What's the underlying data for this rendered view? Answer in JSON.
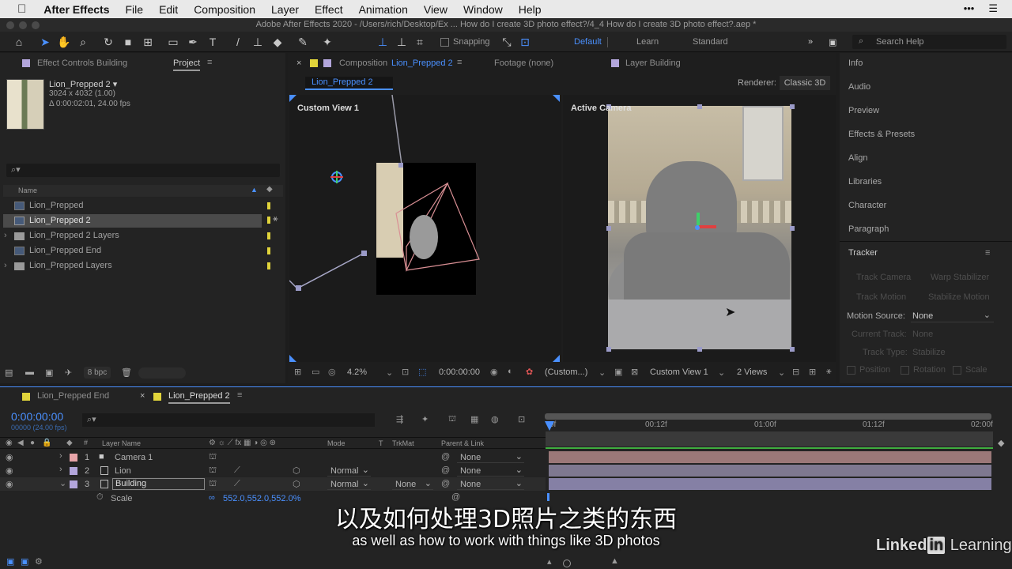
{
  "menubar": {
    "apple": "",
    "app_name": "After Effects",
    "items": [
      "File",
      "Edit",
      "Composition",
      "Layer",
      "Effect",
      "Animation",
      "View",
      "Window",
      "Help"
    ]
  },
  "window_title": "Adobe After Effects 2020 - /Users/rich/Desktop/Ex ... How do I create 3D photo effect?/4_4 How do I create 3D photo effect?.aep *",
  "toolbar": {
    "snapping_label": "Snapping",
    "workspaces": [
      "Default",
      "Learn",
      "Standard"
    ],
    "search_placeholder": "Search Help"
  },
  "project_panel": {
    "tab_effect_controls": "Effect Controls Building",
    "tab_project": "Project",
    "selected_name": "Lion_Prepped 2 ▾",
    "selected_dims": "3024 x 4032 (1.00)",
    "selected_duration": "Δ 0:00:02:01, 24.00 fps",
    "search_icon_label": "⌕▾",
    "column_name": "Name",
    "items": [
      {
        "name": "Lion_Prepped",
        "type": "comp",
        "selected": false,
        "folder": false
      },
      {
        "name": "Lion_Prepped 2",
        "type": "comp",
        "selected": true,
        "folder": false
      },
      {
        "name": "Lion_Prepped 2 Layers",
        "type": "folder",
        "selected": false,
        "folder": true
      },
      {
        "name": "Lion_Prepped End",
        "type": "comp",
        "selected": false,
        "folder": false
      },
      {
        "name": "Lion_Prepped Layers",
        "type": "folder",
        "selected": false,
        "folder": true
      }
    ],
    "bpc": "8 bpc"
  },
  "comp_panel": {
    "tab_composition": "Composition",
    "tab_comp_name": "Lion_Prepped 2",
    "tab_footage": "Footage (none)",
    "tab_layer": "Layer Building",
    "breadcrumb": "Lion_Prepped 2",
    "renderer_label": "Renderer:",
    "renderer_value": "Classic 3D",
    "view_left_label": "Custom View 1",
    "view_right_label": "Active Camera",
    "zoom": "4.2%",
    "timecode": "0:00:00:00",
    "resolution": "(Custom...)",
    "view_select": "Custom View 1",
    "views_count": "2 Views"
  },
  "right_panel": {
    "items": [
      "Info",
      "Audio",
      "Preview",
      "Effects & Presets",
      "Align",
      "Libraries",
      "Character",
      "Paragraph"
    ],
    "tracker_title": "Tracker",
    "track_camera": "Track Camera",
    "warp_stabilizer": "Warp Stabilizer",
    "track_motion": "Track Motion",
    "stabilize_motion": "Stabilize Motion",
    "motion_source_label": "Motion Source:",
    "motion_source_value": "None",
    "current_track_label": "Current Track:",
    "current_track_value": "None",
    "track_type_label": "Track Type:",
    "track_type_value": "Stabilize",
    "position": "Position",
    "rotation": "Rotation",
    "scale": "Scale"
  },
  "timeline": {
    "tab1": "Lion_Prepped End",
    "tab2": "Lion_Prepped 2",
    "timecode": "0:00:00:00",
    "timecode_sub": "00000 (24.00 fps)",
    "col_layer_name": "Layer Name",
    "col_mode": "Mode",
    "col_t": "T",
    "col_trkmat": "TrkMat",
    "col_parent": "Parent & Link",
    "ruler": [
      "0f",
      "00:12f",
      "01:00f",
      "01:12f",
      "02:00f"
    ],
    "layers": [
      {
        "num": "1",
        "name": "Camera 1",
        "mode": "",
        "trkmat": "",
        "parent": "None",
        "color": "#e7a4a9"
      },
      {
        "num": "2",
        "name": "Lion",
        "mode": "Normal",
        "trkmat": "",
        "parent": "None",
        "color": "#b3a6dc"
      },
      {
        "num": "3",
        "name": "Building",
        "mode": "Normal",
        "trkmat": "None",
        "parent": "None",
        "color": "#b3a6dc"
      }
    ],
    "scale_label": "Scale",
    "scale_value": "552.0,552.0,552.0%"
  },
  "subtitles": {
    "cn": "以及如何处理3D照片之类的东西",
    "en": "as well as how to work with things like 3D photos"
  },
  "watermark": "Linked in Learning"
}
